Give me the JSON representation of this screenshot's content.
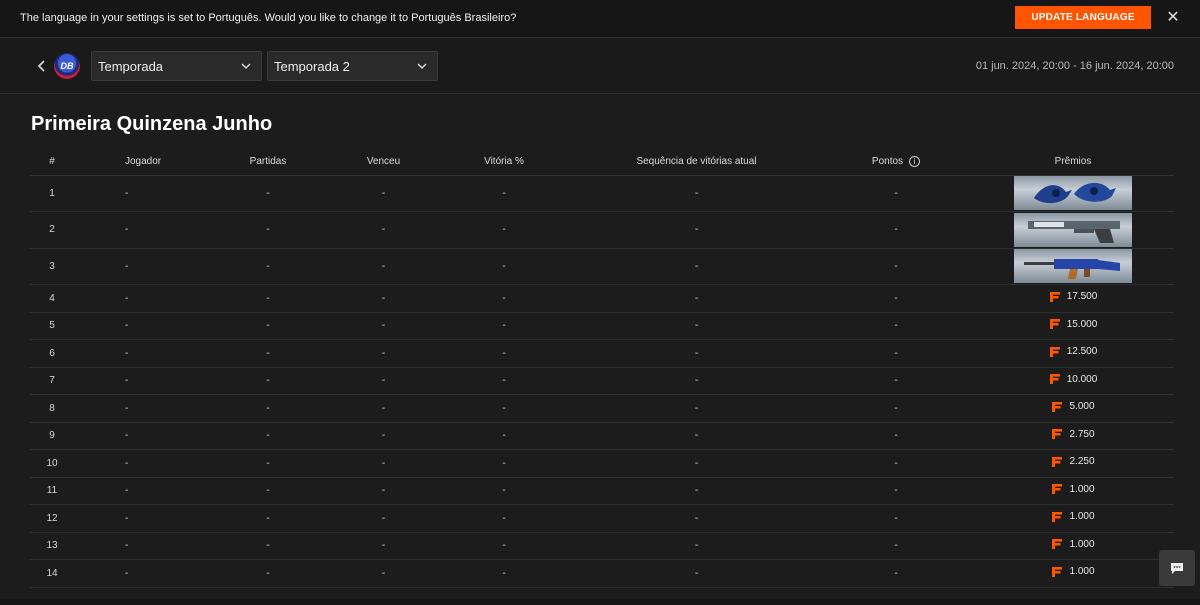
{
  "banner": {
    "message": "The language in your settings is set to Português. Would you like to change it to Português Brasileiro?",
    "button_label": "UPDATE LANGUAGE",
    "close_glyph": "✕"
  },
  "topbar": {
    "back_glyph": "‹",
    "logo_text": "DB",
    "select1_value": "Temporada",
    "select2_value": "Temporada 2",
    "date_range": "01 jun. 2024, 20:00 - 16 jun. 2024, 20:00"
  },
  "page_title": "Primeira Quinzena Junho",
  "table": {
    "headers": {
      "rank": "#",
      "player": "Jogador",
      "matches": "Partidas",
      "wins": "Venceu",
      "win_pct": "Vitória %",
      "streak": "Sequência de vitórias atual",
      "points": "Pontos",
      "prizes": "Prêmios"
    },
    "rows": [
      {
        "rank": "1",
        "player": "-",
        "matches": "-",
        "wins": "-",
        "win_pct": "-",
        "streak": "-",
        "points": "-",
        "prize_type": "item",
        "prize_icon": "knife-skin"
      },
      {
        "rank": "2",
        "player": "-",
        "matches": "-",
        "wins": "-",
        "win_pct": "-",
        "streak": "-",
        "points": "-",
        "prize_type": "item",
        "prize_icon": "pistol-skin"
      },
      {
        "rank": "3",
        "player": "-",
        "matches": "-",
        "wins": "-",
        "win_pct": "-",
        "streak": "-",
        "points": "-",
        "prize_type": "item",
        "prize_icon": "rifle-skin"
      },
      {
        "rank": "4",
        "player": "-",
        "matches": "-",
        "wins": "-",
        "win_pct": "-",
        "streak": "-",
        "points": "-",
        "prize_type": "coins",
        "prize": "17.500"
      },
      {
        "rank": "5",
        "player": "-",
        "matches": "-",
        "wins": "-",
        "win_pct": "-",
        "streak": "-",
        "points": "-",
        "prize_type": "coins",
        "prize": "15.000"
      },
      {
        "rank": "6",
        "player": "-",
        "matches": "-",
        "wins": "-",
        "win_pct": "-",
        "streak": "-",
        "points": "-",
        "prize_type": "coins",
        "prize": "12.500"
      },
      {
        "rank": "7",
        "player": "-",
        "matches": "-",
        "wins": "-",
        "win_pct": "-",
        "streak": "-",
        "points": "-",
        "prize_type": "coins",
        "prize": "10.000"
      },
      {
        "rank": "8",
        "player": "-",
        "matches": "-",
        "wins": "-",
        "win_pct": "-",
        "streak": "-",
        "points": "-",
        "prize_type": "coins",
        "prize": "5.000"
      },
      {
        "rank": "9",
        "player": "-",
        "matches": "-",
        "wins": "-",
        "win_pct": "-",
        "streak": "-",
        "points": "-",
        "prize_type": "coins",
        "prize": "2.750"
      },
      {
        "rank": "10",
        "player": "-",
        "matches": "-",
        "wins": "-",
        "win_pct": "-",
        "streak": "-",
        "points": "-",
        "prize_type": "coins",
        "prize": "2.250"
      },
      {
        "rank": "11",
        "player": "-",
        "matches": "-",
        "wins": "-",
        "win_pct": "-",
        "streak": "-",
        "points": "-",
        "prize_type": "coins",
        "prize": "1.000"
      },
      {
        "rank": "12",
        "player": "-",
        "matches": "-",
        "wins": "-",
        "win_pct": "-",
        "streak": "-",
        "points": "-",
        "prize_type": "coins",
        "prize": "1.000"
      },
      {
        "rank": "13",
        "player": "-",
        "matches": "-",
        "wins": "-",
        "win_pct": "-",
        "streak": "-",
        "points": "-",
        "prize_type": "coins",
        "prize": "1.000"
      },
      {
        "rank": "14",
        "player": "-",
        "matches": "-",
        "wins": "-",
        "win_pct": "-",
        "streak": "-",
        "points": "-",
        "prize_type": "coins",
        "prize": "1.000"
      }
    ]
  },
  "colors": {
    "accent": "#ff5500",
    "background": "#1c1c1c",
    "banner_bg": "#161616"
  },
  "icons": {
    "coin": "faceit-f-icon",
    "info": "info-icon",
    "chat": "chat-icon"
  }
}
